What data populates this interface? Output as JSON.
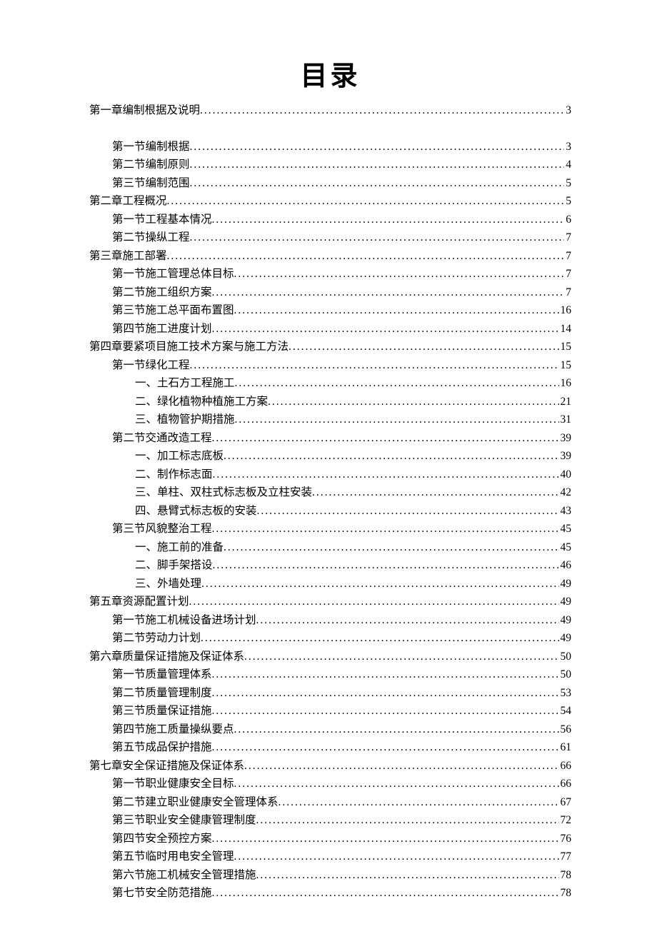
{
  "title": "目录",
  "entries": [
    {
      "label": "第一章编制根据及说明",
      "page": "3",
      "indent": 0
    },
    {
      "spacer": true
    },
    {
      "label": "第一节编制根据",
      "page": "3",
      "indent": 1
    },
    {
      "label": "第二节编制原则",
      "page": "4",
      "indent": 1
    },
    {
      "label": "第三节编制范围",
      "page": "5",
      "indent": 1
    },
    {
      "label": "第二章工程概况",
      "page": "5",
      "indent": 0
    },
    {
      "label": "第一节工程基本情况",
      "page": "6",
      "indent": 1
    },
    {
      "label": "第二节操纵工程",
      "page": "7",
      "indent": 1
    },
    {
      "label": "第三章施工部署",
      "page": "7",
      "indent": 0
    },
    {
      "label": "第一节施工管理总体目标",
      "page": "7",
      "indent": 1
    },
    {
      "label": "第二节施工组织方案",
      "page": "7",
      "indent": 1
    },
    {
      "label": "第三节施工总平面布置图",
      "page": "16",
      "indent": 1
    },
    {
      "label": "第四节施工进度计划",
      "page": "14",
      "indent": 1
    },
    {
      "label": "第四章要紧项目施工技术方案与施工方法",
      "page": "15",
      "indent": 0
    },
    {
      "label": "第一节绿化工程",
      "page": "15",
      "indent": 1
    },
    {
      "label": "一、土石方工程施工",
      "page": "16",
      "indent": 2
    },
    {
      "label": "二、绿化植物种植施工方案",
      "page": "21",
      "indent": 2
    },
    {
      "label": "三、植物管护期措施",
      "page": "31",
      "indent": 2
    },
    {
      "label": "第二节交通改造工程",
      "page": "39",
      "indent": 1
    },
    {
      "label": "一、加工标志底板",
      "page": "39",
      "indent": 2
    },
    {
      "label": "二、制作标志面",
      "page": "40",
      "indent": 2
    },
    {
      "label": "三、单柱、双柱式标志板及立柱安装",
      "page": "42",
      "indent": 2
    },
    {
      "label": "四、悬臂式标志板的安装",
      "page": "43",
      "indent": 2
    },
    {
      "label": "第三节风貌整治工程",
      "page": "45",
      "indent": 1
    },
    {
      "label": "一、施工前的准备",
      "page": "45",
      "indent": 2
    },
    {
      "label": "二、脚手架搭设",
      "page": "46",
      "indent": 2
    },
    {
      "label": "三、外墙处理",
      "page": "49",
      "indent": 2
    },
    {
      "label": "第五章资源配置计划",
      "page": "49",
      "indent": 0
    },
    {
      "label": "第一节施工机械设备进场计划",
      "page": "49",
      "indent": 1
    },
    {
      "label": "第二节劳动力计划",
      "page": "49",
      "indent": 1
    },
    {
      "label": "第六章质量保证措施及保证体系",
      "page": "50",
      "indent": 0
    },
    {
      "label": "第一节质量管理体系",
      "page": "50",
      "indent": 1
    },
    {
      "label": "第二节质量管理制度",
      "page": "53",
      "indent": 1
    },
    {
      "label": "第三节质量保证措施",
      "page": "54",
      "indent": 1
    },
    {
      "label": "第四节施工质量操纵要点",
      "page": "56",
      "indent": 1
    },
    {
      "label": "第五节成品保护措施",
      "page": "61",
      "indent": 1
    },
    {
      "label": "第七章安全保证措施及保证体系",
      "page": "66",
      "indent": 0
    },
    {
      "label": "第一节职业健康安全目标",
      "page": "66",
      "indent": 1
    },
    {
      "label": "第二节建立职业健康安全管理体系",
      "page": "67",
      "indent": 1
    },
    {
      "label": "第三节职业安全健康管理制度",
      "page": "72",
      "indent": 1
    },
    {
      "label": "第四节安全预控方案",
      "page": "76",
      "indent": 1
    },
    {
      "label": "第五节临时用电安全管理",
      "page": "77",
      "indent": 1
    },
    {
      "label": "第六节施工机械安全管理措施",
      "page": "78",
      "indent": 1
    },
    {
      "label": "第七节安全防范措施",
      "page": "78",
      "indent": 1
    }
  ]
}
